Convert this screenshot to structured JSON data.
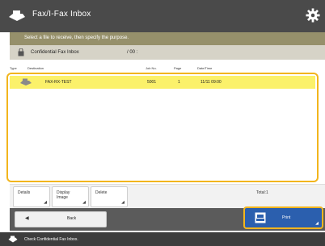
{
  "header": {
    "title": "Fax/I-Fax Inbox",
    "title_icon": "fax-inbox-icon",
    "settings_icon": "gear-icon"
  },
  "instruction": "Select a file to receive, then specify the purpose.",
  "inbox": {
    "label": "Confidential Fax Inbox",
    "count": "/ 00 :"
  },
  "columns": {
    "type": "Type",
    "destination": "Destination",
    "job_no": "Job No.",
    "pages": "Page",
    "datetime": "Date/Time"
  },
  "rows": [
    {
      "type_icon": "fax-icon",
      "destination": "FAX-RX-TEST",
      "job_no": "5001",
      "pages": "1",
      "datetime": "11/11 09:00",
      "selected": true
    }
  ],
  "buttons": {
    "details": "Details",
    "display_image": "Display\nImage",
    "delete": "Delete",
    "back": "Back",
    "print": "Print"
  },
  "total": "Total:1",
  "status": "Check Confidential Fax Inbox.",
  "colors": {
    "titlebar": "#4a4a4a",
    "instruction_bar": "#96906b",
    "selection": "#fbf16a",
    "focus_border": "#f2b51d",
    "primary_button": "#2b5fae"
  }
}
